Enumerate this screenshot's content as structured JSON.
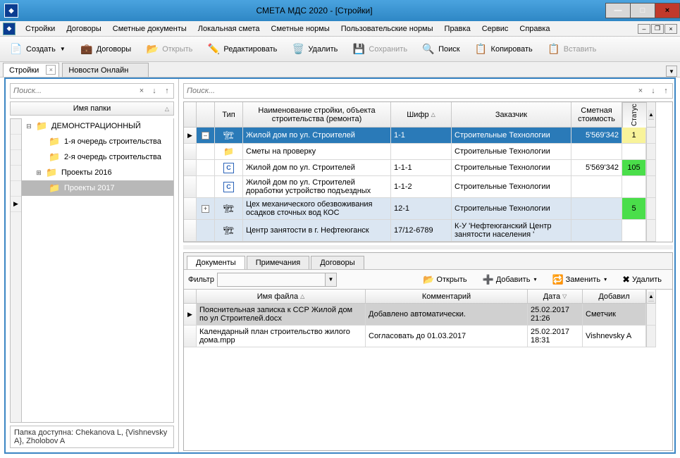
{
  "window": {
    "title": "СМЕТА МДС 2020   - [Стройки]",
    "minimize": "—",
    "maximize": "□",
    "close": "×"
  },
  "menu": [
    "Стройки",
    "Договоры",
    "Сметные документы",
    "Локальная смета",
    "Сметные нормы",
    "Пользовательские нормы",
    "Правка",
    "Сервис",
    "Справка"
  ],
  "doc_controls": {
    "min": "–",
    "restore": "❐",
    "close": "×"
  },
  "toolbar": {
    "create": "Создать",
    "contracts": "Договоры",
    "open": "Открыть",
    "edit": "Редактировать",
    "delete": "Удалить",
    "save": "Сохранить",
    "search": "Поиск",
    "copy": "Копировать",
    "paste": "Вставить"
  },
  "tabs": {
    "t0": "Стройки",
    "t1": "Новости Онлайн"
  },
  "left": {
    "search_placeholder": "Поиск...",
    "header": "Имя папки",
    "nodes": {
      "root": "ДЕМОНСТРАЦИОННЫЙ",
      "n1": "1-я очередь строительства",
      "n2": "2-я очередь строительства",
      "n3": "Проекты 2016",
      "n4": "Проекты 2017"
    },
    "status": "Папка доступна: Chekanova L, {Vishnevsky A}, Zholobov A"
  },
  "right": {
    "search_placeholder": "Поиск...",
    "columns": {
      "type": "Тип",
      "name": "Наименование стройки, объекта строительства (ремонта)",
      "code": "Шифр",
      "customer": "Заказчик",
      "cost": "Сметная стоимость",
      "status": "Статус"
    },
    "rows": [
      {
        "exp": "–",
        "icon": "build",
        "name": "Жилой дом по ул. Строителей",
        "code": "1-1",
        "customer": "Строительные Технологии",
        "cost": "5'569'342",
        "status": "1",
        "st": "y",
        "sel": true,
        "marker": "▶"
      },
      {
        "exp": "",
        "icon": "fold",
        "name": "Сметы на проверку",
        "code": "",
        "customer": "Строительные Технологии",
        "cost": "",
        "status": "",
        "st": ""
      },
      {
        "exp": "",
        "icon": "c",
        "name": "Жилой дом по ул. Строителей",
        "code": "1-1-1",
        "customer": "Строительные Технологии",
        "cost": "5'569'342",
        "status": "105",
        "st": "g"
      },
      {
        "exp": "",
        "icon": "c",
        "name": "Жилой дом по ул. Строителей доработки устройство подъездных",
        "code": "1-1-2",
        "customer": "Строительные Технологии",
        "cost": "",
        "status": "",
        "st": ""
      },
      {
        "exp": "+",
        "icon": "build",
        "name": "Цех механического обезвоживания осадков сточных вод КОС",
        "code": "12-1",
        "customer": "Строительные Технологии",
        "cost": "",
        "status": "5",
        "st": "g",
        "alt": true
      },
      {
        "exp": "",
        "icon": "build",
        "name": "Центр занятости в г. Нефтеюганск",
        "code": "17/12-6789",
        "customer": "К-У 'Нефтеюганский Центр занятости населения '",
        "cost": "",
        "status": "",
        "st": "",
        "alt": true
      }
    ]
  },
  "bottom": {
    "tabs": {
      "t0": "Документы",
      "t1": "Примечания",
      "t2": "Договоры"
    },
    "filter_label": "Фильтр",
    "btns": {
      "open": "Открыть",
      "add": "Добавить",
      "replace": "Заменить",
      "delete": "Удалить"
    },
    "cols": {
      "file": "Имя файла",
      "comment": "Комментарий",
      "date": "Дата",
      "user": "Добавил"
    },
    "rows": [
      {
        "file": "Пояснительная записка к ССР Жилой дом по ул Строителей.docx",
        "comment": "Добавлено автоматически.",
        "date": "25.02.2017 21:26",
        "user": "Сметчик",
        "sel": true,
        "marker": "▶"
      },
      {
        "file": "Календарный план строительство жилого дома.mpp",
        "comment": "Согласовать до 01.03.2017",
        "date": "25.02.2017 18:31",
        "user": "Vishnevsky A"
      }
    ]
  }
}
